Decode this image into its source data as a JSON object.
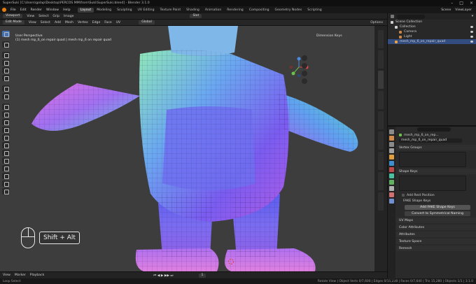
{
  "titlebar": {
    "title": "SuperSuki [C:\\Users\\golap\\Desktop\\PERCOS MM\\from\\Suki\\SuperSuki.blend] - Blender 3.1.0"
  },
  "menu": {
    "items": [
      "File",
      "Edit",
      "Render",
      "Window",
      "Help"
    ],
    "workspaces": [
      "Layout",
      "Modeling",
      "Sculpting",
      "UV Editing",
      "Texture Paint",
      "Shading",
      "Animation",
      "Rendering",
      "Compositing",
      "Geometry Nodes",
      "Scripting"
    ],
    "active_workspace": "Layout",
    "scene_label": "Scene",
    "view_layer_label": "ViewLayer"
  },
  "header": {
    "editor_type": "Viewport",
    "menus": [
      "View",
      "Select",
      "Grip",
      "Image"
    ],
    "slot": "Slot",
    "mode": "Edit Mode",
    "view_menus": [
      "View",
      "Select",
      "Add",
      "Mesh",
      "Vertex",
      "Edge",
      "Face",
      "UV"
    ],
    "transform": "Global",
    "options": "Options"
  },
  "viewport": {
    "perspective": "User Perspective",
    "object_info": "(1) mesh mp_6_on repair quad | mesh mp_6 on repair quad",
    "overlay_label": "Dimension Keys",
    "key_hint": "Shift + Alt",
    "loop_select": "Loop Select"
  },
  "tabs_vertical": [
    "Item",
    "Tool",
    "View",
    "Edit",
    "Screencast Keys",
    "Animation",
    "BlenderKit",
    "Create",
    "HardOps"
  ],
  "timeline": {
    "items": [
      "View",
      "Marker",
      "Playback"
    ],
    "frame": "1"
  },
  "status": {
    "left": "Loop Select",
    "right": "Rotate View | Object   Verts 0/7,600 | Edges 0/15,238 | Faces 0/7,640 | Tris 15,280 | Objects 1/1 | 3.1.0"
  },
  "outliner": {
    "search_placeholder": "",
    "rows": [
      {
        "label": "Scene Collection",
        "indent": 0,
        "color": "#cfcfcf",
        "selected": false
      },
      {
        "label": "Collection",
        "indent": 1,
        "color": "#cfcfcf",
        "selected": false
      },
      {
        "label": "Camera",
        "indent": 2,
        "color": "#c9864a",
        "selected": false
      },
      {
        "label": "Light",
        "indent": 2,
        "color": "#c9864a",
        "selected": false
      },
      {
        "label": "mesh_mp_6_on_repair_quad",
        "indent": 1,
        "color": "#e8a04a",
        "selected": true
      }
    ]
  },
  "properties": {
    "search_placeholder": "",
    "object_name": "mesh_mp_6_on_rep...",
    "mesh_name": "mesh_mp_6_on_repair_quad",
    "panels": {
      "vertex_groups": "Vertex Groups",
      "shape_keys": "Shape Keys",
      "add_rest": "Add Rest Position",
      "shape_keys_sub": "FAKE Shape Keys",
      "add_fake": "Add FAKE Shape Keys",
      "convert": "Convert to Symmetrical Naming",
      "uv_maps": "UV Maps",
      "color_attributes": "Color Attributes",
      "attributes": "Attributes",
      "texture_space": "Texture Space",
      "remesh": "Remesh"
    },
    "tab_colors": [
      "#8a8a8a",
      "#d08a4a",
      "#8a8a8a",
      "#a0a0a0",
      "#e0a040",
      "#3f8fd0",
      "#c04a4a",
      "#4ac0a0",
      "#60b060",
      "#b0b0b0",
      "#d07070",
      "#7090d0"
    ]
  }
}
